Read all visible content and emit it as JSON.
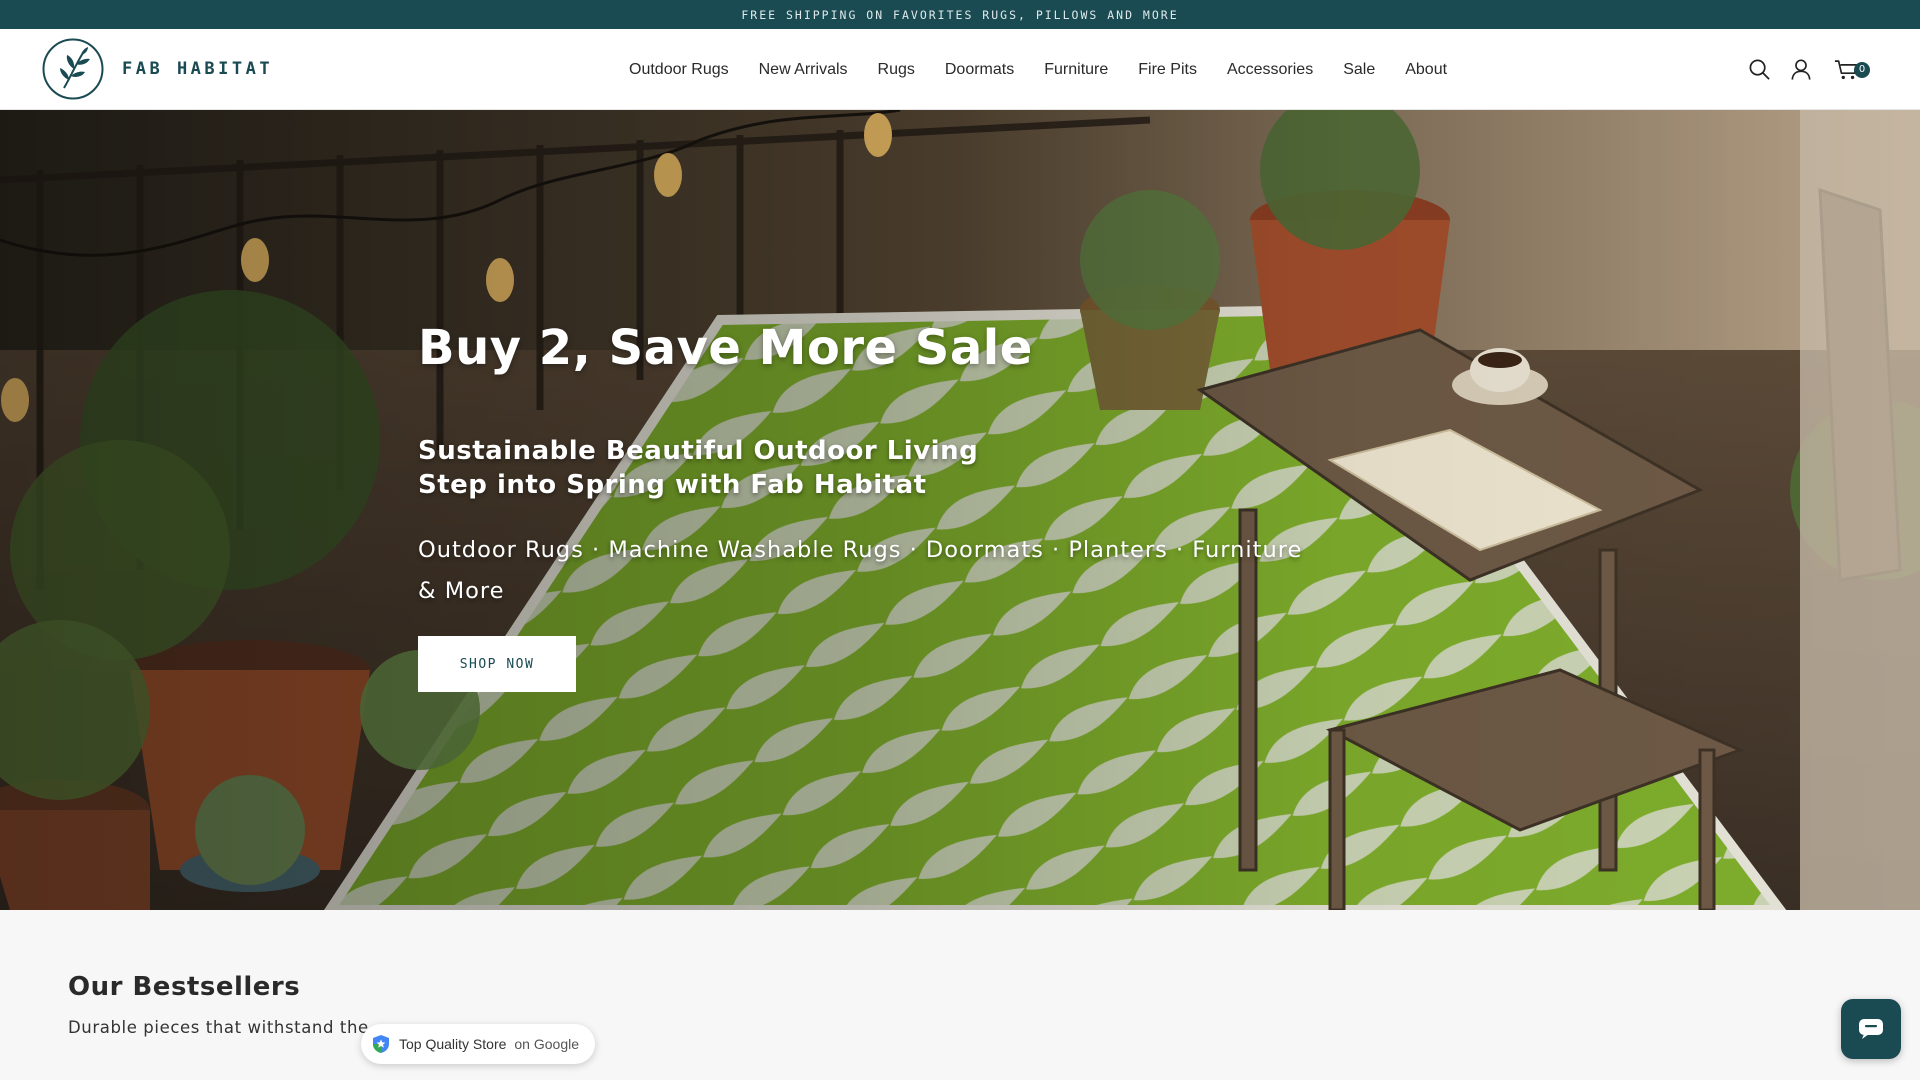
{
  "announcement": {
    "text": "FREE SHIPPING ON FAVORITES RUGS, PILLOWS AND MORE"
  },
  "brand": {
    "name": "FAB HABITAT",
    "color": "#1a4a52"
  },
  "nav": {
    "items": [
      {
        "label": "Outdoor Rugs"
      },
      {
        "label": "New Arrivals"
      },
      {
        "label": "Rugs"
      },
      {
        "label": "Doormats"
      },
      {
        "label": "Furniture"
      },
      {
        "label": "Fire Pits"
      },
      {
        "label": "Accessories"
      },
      {
        "label": "Sale"
      },
      {
        "label": "About"
      }
    ]
  },
  "header_icons": {
    "search": "search-icon",
    "account": "user-icon",
    "cart": "cart-icon",
    "cart_count": "0"
  },
  "hero": {
    "title": "Buy 2, Save More Sale",
    "subtitle_line1": "Sustainable Beautiful Outdoor Living",
    "subtitle_line2": "Step into Spring with Fab Habitat",
    "categories": "Outdoor Rugs · Machine Washable Rugs · Doormats · Planters · Furniture & More",
    "cta": "SHOP NOW"
  },
  "bestsellers": {
    "title": "Our Bestsellers",
    "description": "Durable pieces that withstand the"
  },
  "trust_badge": {
    "text": "Top Quality Store",
    "suffix": "on Google"
  },
  "chat": {
    "icon": "chat-icon"
  }
}
